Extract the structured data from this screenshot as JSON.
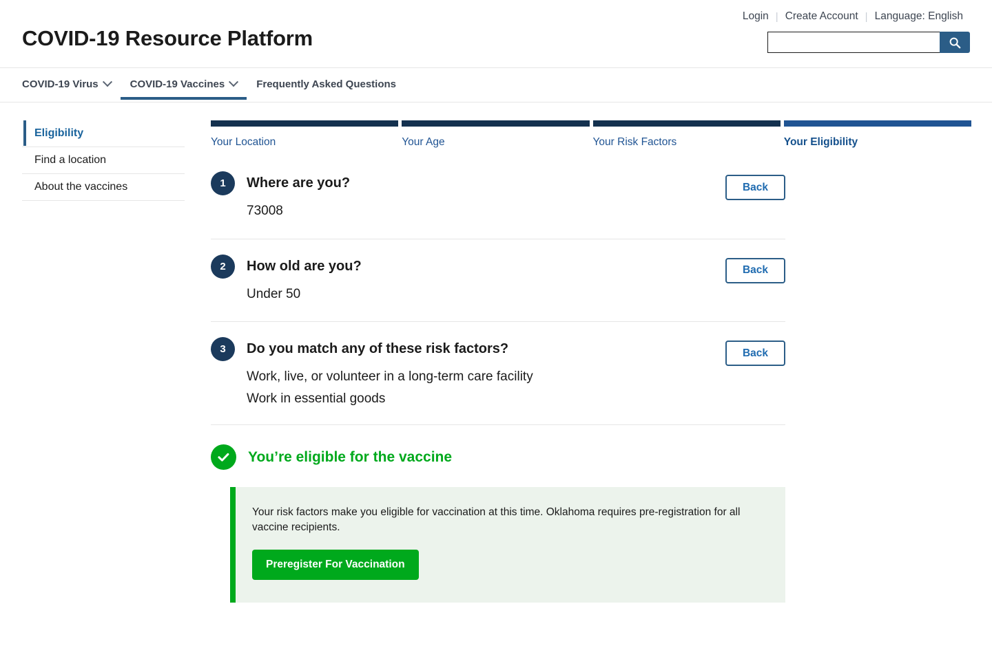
{
  "header": {
    "site_title": "COVID-19 Resource Platform",
    "util_nav": [
      {
        "label": "Login"
      },
      {
        "label": "Create Account"
      },
      {
        "label": "Language: English"
      }
    ],
    "separator": "|",
    "search": {
      "value": "",
      "placeholder": "",
      "icon": "search-icon"
    }
  },
  "primary_nav": {
    "items": [
      {
        "label": "COVID-19 Virus",
        "has_chevron": true,
        "active": false
      },
      {
        "label": "COVID-19 Vaccines",
        "has_chevron": true,
        "active": true
      },
      {
        "label": "Frequently Asked Questions",
        "has_chevron": false,
        "active": false
      }
    ]
  },
  "sidebar": {
    "items": [
      {
        "label": "Eligibility",
        "active": true
      },
      {
        "label": "Find a location",
        "active": false
      },
      {
        "label": "About the vaccines",
        "active": false
      }
    ]
  },
  "stepper": {
    "steps": [
      {
        "label": "Your Location",
        "current": false
      },
      {
        "label": "Your Age",
        "current": false
      },
      {
        "label": "Your Risk Factors",
        "current": false
      },
      {
        "label": "Your Eligibility",
        "current": true
      }
    ]
  },
  "questions": [
    {
      "number": "1",
      "title": "Where are you?",
      "answers": [
        "73008"
      ],
      "back_label": "Back"
    },
    {
      "number": "2",
      "title": "How old are you?",
      "answers": [
        "Under 50"
      ],
      "back_label": "Back"
    },
    {
      "number": "3",
      "title": "Do you match any of these risk factors?",
      "answers": [
        "Work, live, or volunteer in a long-term care facility",
        "Work in essential goods"
      ],
      "back_label": "Back"
    }
  ],
  "result": {
    "icon": "check-circle-icon",
    "heading": "You’re eligible for the vaccine",
    "alert_text": "Your risk factors make you eligible for vaccination at this time. Oklahoma requires pre-registration for all vaccine recipients.",
    "alert_button": "Preregister For Vaccination"
  },
  "colors": {
    "brand_blue": "#2b5d87",
    "navy": "#14314f",
    "link_blue": "#19639c",
    "success_green": "#00a91c",
    "alert_bg": "#ecf3ec"
  }
}
